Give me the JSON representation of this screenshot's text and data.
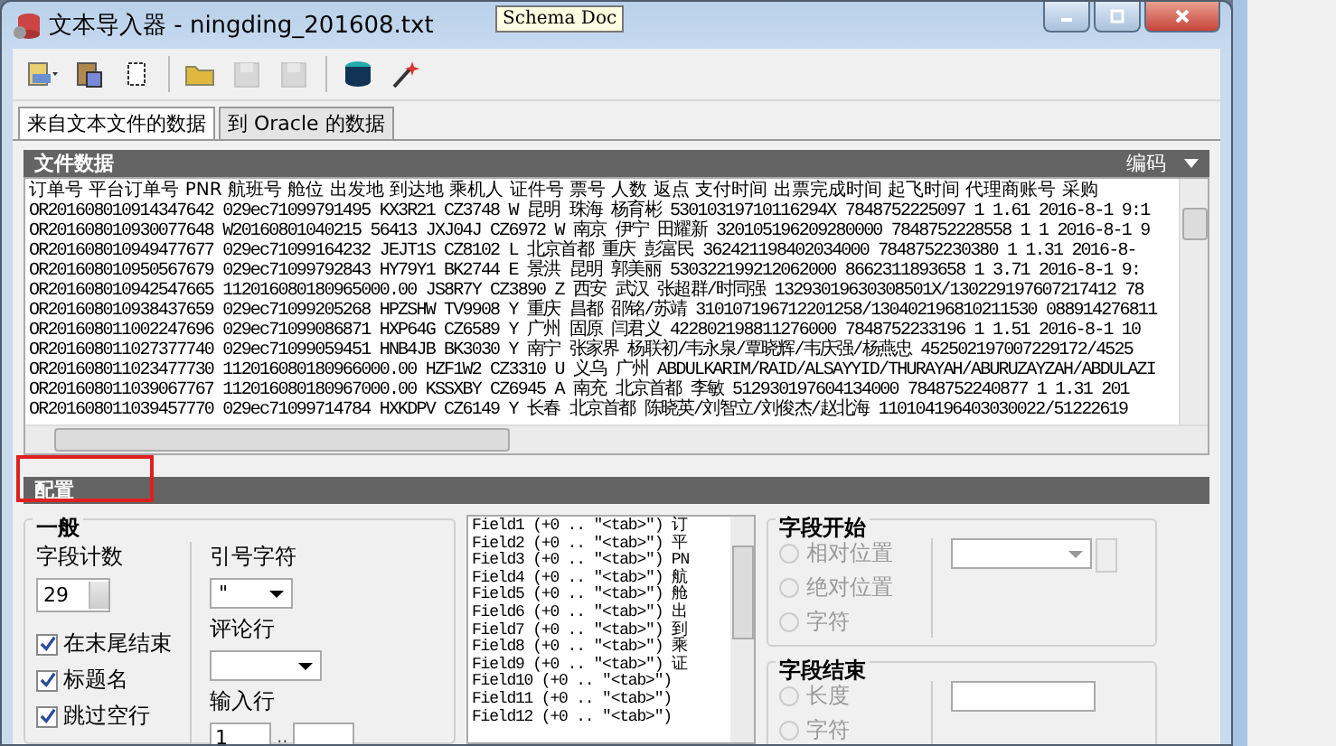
{
  "window": {
    "title": "文本导入器 - ningding_201608.txt"
  },
  "tooltip": "Schema Doc",
  "toolbar": [
    {
      "kind": "import",
      "disabled": false
    },
    {
      "kind": "paste",
      "disabled": false
    },
    {
      "kind": "new",
      "disabled": false
    },
    {
      "kind": "folder",
      "disabled": false
    },
    {
      "kind": "save",
      "disabled": true
    },
    {
      "kind": "save",
      "disabled": true
    },
    {
      "kind": "database",
      "disabled": false
    },
    {
      "kind": "wand",
      "disabled": false
    }
  ],
  "tabs": [
    {
      "label": "来自文本文件的数据",
      "selected": true
    },
    {
      "label": "到 Oracle 的数据",
      "selected": false
    }
  ],
  "file_data": {
    "title": "文件数据",
    "encoding": "编码",
    "lines": [
      "订单号 平台订单号 PNR 航班号 舱位 出发地 到达地 乘机人 证件号 票号 人数 返点 支付时间 出票完成时间 起飞时间 代理商账号 采购",
      "OR201608010914347642 029ec71099791495 KX3R21 CZ3748 W 昆明 珠海 杨育彬 53010319710116294X 7848752225097  1 1.61 2016-8-1 9:1",
      "OR201608010930077648 W20160801040215 56413 JXJ04J CZ6972 W 南京 伊宁 田耀新 320105196209280000  7848752228558  1 1 2016-8-1 9",
      "OR201608010949477677 029ec71099164232 JEJT1S CZ8102 L 北京首都 重庆 彭富民 362421198402034000  7848752230380  1 1.31 2016-8-",
      "OR201608010950567679 029ec71099792843 HY79Y1 BK2744 E 景洪 昆明 郭美丽 530322199212062000  8662311893658  1 3.71 2016-8-1 9:",
      "OR201608010942547665 112016080180965000.00  JS8R7Y CZ3890 Z 西安 武汉 张超群/时同强 13293019630308501X/130229197607217412 78",
      "OR201608010938437659 029ec71099205268 HPZSHW TV9908 Y 重庆 昌都 邵铭/苏靖 310107196712201258/130402196810211530 088914276811",
      "OR201608011002247696 029ec71099086871 HXP64G CZ6589 Y 广州 固原 闫君义 422802198811276000  7848752233196  1 1.51 2016-8-1 10",
      "OR201608011027377740 029ec71099059451 HNB4JB BK3030 Y 南宁 张家界 杨联初/韦永泉/覃晓辉/韦庆强/杨燕忠 452502197007229172/4525",
      "OR201608011023477730 112016080180966000.00  HZF1W2 CZ3310 U 义乌 广州 ABDULKARIM/RAID/ALSAYYID/THURAYAH/ABURUZAYZAH/ABDULAZI",
      "OR201608011039067767 112016080180967000.00  KSSXBY CZ6945 A 南充 北京首都 李敏 512930197604134000  7848752240877  1 1.31 201",
      "OR201608011039457770 029ec71099714784 HXKDPV CZ6149 Y 长春 北京首都 陈晓英/刘智立/刘俊杰/赵北海 110104196403030022/51222619"
    ]
  },
  "config": {
    "title": "配置",
    "general": {
      "title": "一般",
      "field_count_label": "字段计数",
      "field_count": "29",
      "checkboxes": [
        {
          "label": "在末尾结束",
          "checked": true
        },
        {
          "label": "标题名",
          "checked": true
        },
        {
          "label": "跳过空行",
          "checked": true
        }
      ],
      "quote_label": "引号字符",
      "quote_value": "\"",
      "comment_label": "评论行",
      "input_rows_label": "输入行",
      "input_rows_from": "1",
      "range_separator": ".."
    },
    "fields": [
      {
        "name": "Field1",
        "spec": "(+0 .. \"<tab>\")",
        "column": "订"
      },
      {
        "name": "Field2",
        "spec": "(+0 .. \"<tab>\")",
        "column": "平"
      },
      {
        "name": "Field3",
        "spec": "(+0 .. \"<tab>\")",
        "column": "PN"
      },
      {
        "name": "Field4",
        "spec": "(+0 .. \"<tab>\")",
        "column": "航"
      },
      {
        "name": "Field5",
        "spec": "(+0 .. \"<tab>\")",
        "column": "舱"
      },
      {
        "name": "Field6",
        "spec": "(+0 .. \"<tab>\")",
        "column": "出"
      },
      {
        "name": "Field7",
        "spec": "(+0 .. \"<tab>\")",
        "column": "到"
      },
      {
        "name": "Field8",
        "spec": "(+0 .. \"<tab>\")",
        "column": "乘"
      },
      {
        "name": "Field9",
        "spec": "(+0 .. \"<tab>\")",
        "column": "证"
      },
      {
        "name": "Field10",
        "spec": "(+0 .. \"<tab>\")"
      },
      {
        "name": "Field11",
        "spec": "(+0 .. \"<tab>\")"
      },
      {
        "name": "Field12",
        "spec": "(+0 .. \"<tab>\")"
      }
    ],
    "field_start": {
      "title": "字段开始",
      "options": [
        {
          "label": "相对位置",
          "selected": false,
          "disabled": true
        },
        {
          "label": "绝对位置",
          "selected": false,
          "disabled": true
        },
        {
          "label": "字符",
          "selected": false,
          "disabled": true
        }
      ]
    },
    "field_end": {
      "title": "字段结束",
      "options": [
        {
          "label": "长度",
          "selected": false,
          "disabled": true
        },
        {
          "label": "字符",
          "selected": false,
          "disabled": true
        }
      ]
    }
  }
}
